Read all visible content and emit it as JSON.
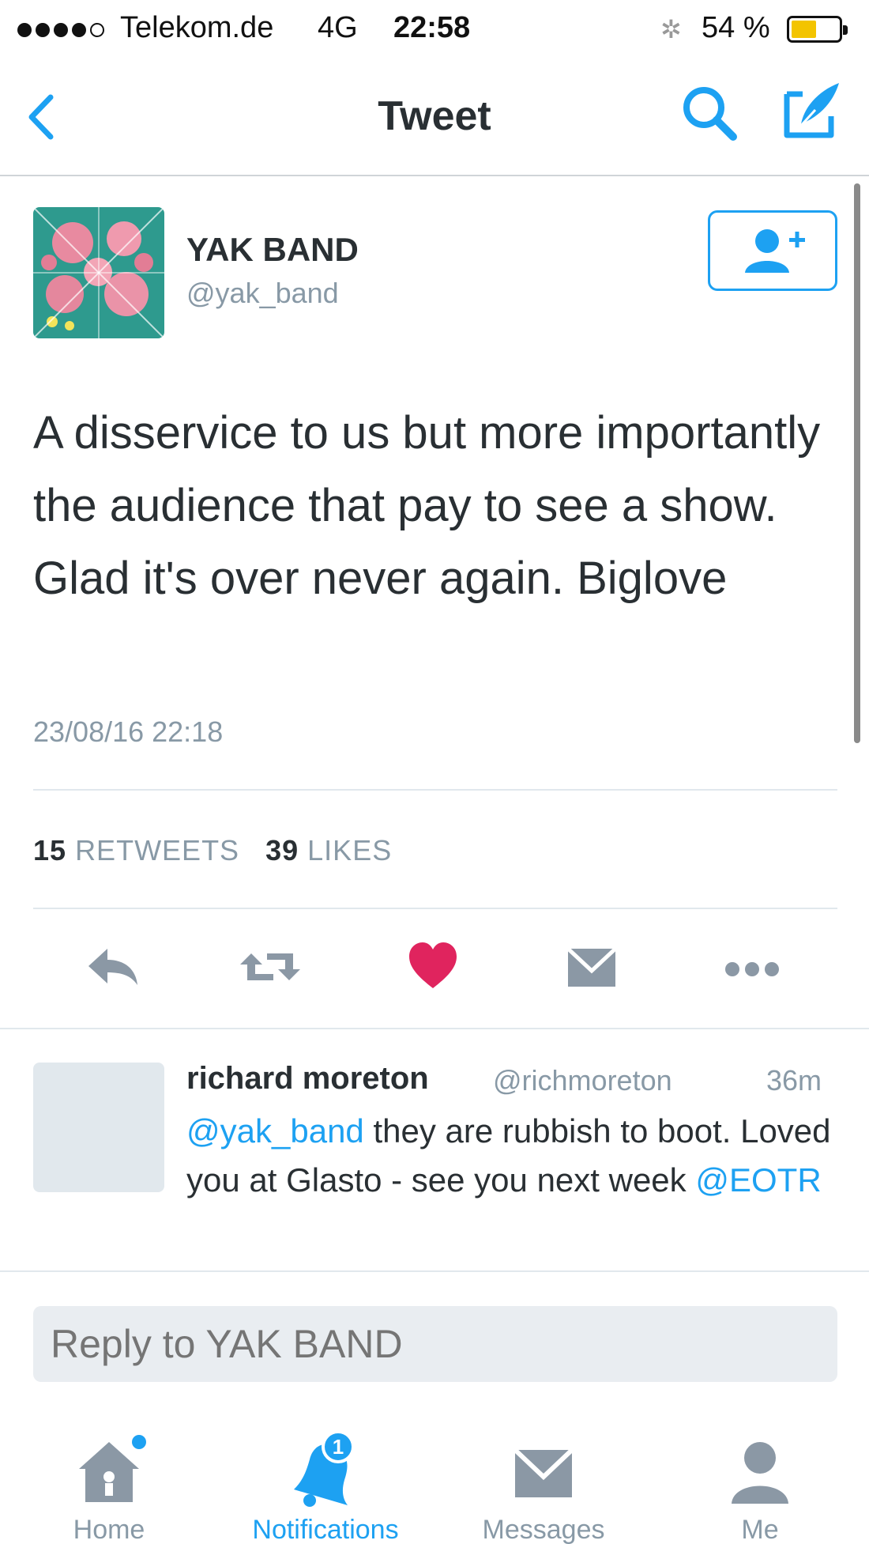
{
  "status_bar": {
    "carrier": "Telekom.de",
    "network": "4G",
    "time": "22:58",
    "battery_percent": "54 %",
    "battery_level": 0.54
  },
  "nav": {
    "title": "Tweet"
  },
  "tweet": {
    "user_name": "YAK BAND",
    "user_handle": "@yak_band",
    "text": "A disservice to us but more importantly the audience that pay to see a show. Glad it's over never again. Biglove",
    "timestamp": "23/08/16 22:18",
    "retweet_count": "15",
    "retweet_label": "RETWEETS",
    "like_count": "39",
    "like_label": "LIKES"
  },
  "reply": {
    "user_name": "richard moreton",
    "user_handle": "@richmoreton",
    "time": "36m",
    "mention_1": "@yak_band",
    "text_1": " they are rubbish to boot. Loved you at Glasto - see you next week ",
    "mention_2": "@EOTR"
  },
  "reply_box": {
    "placeholder": "Reply to YAK BAND"
  },
  "tab_bar": {
    "tabs": [
      {
        "label": "Home"
      },
      {
        "label": "Notifications",
        "badge": "1"
      },
      {
        "label": "Messages"
      },
      {
        "label": "Me"
      }
    ]
  },
  "colors": {
    "accent": "#1da1f2",
    "like": "#e0245e",
    "muted": "#8899a6",
    "icon_gray": "#8b98a5"
  },
  "icons": [
    "back-icon",
    "search-icon",
    "compose-icon",
    "follow-icon",
    "reply-icon",
    "retweet-icon",
    "like-icon",
    "direct-message-icon",
    "more-icon",
    "home-icon",
    "notifications-icon",
    "messages-icon",
    "me-icon"
  ]
}
